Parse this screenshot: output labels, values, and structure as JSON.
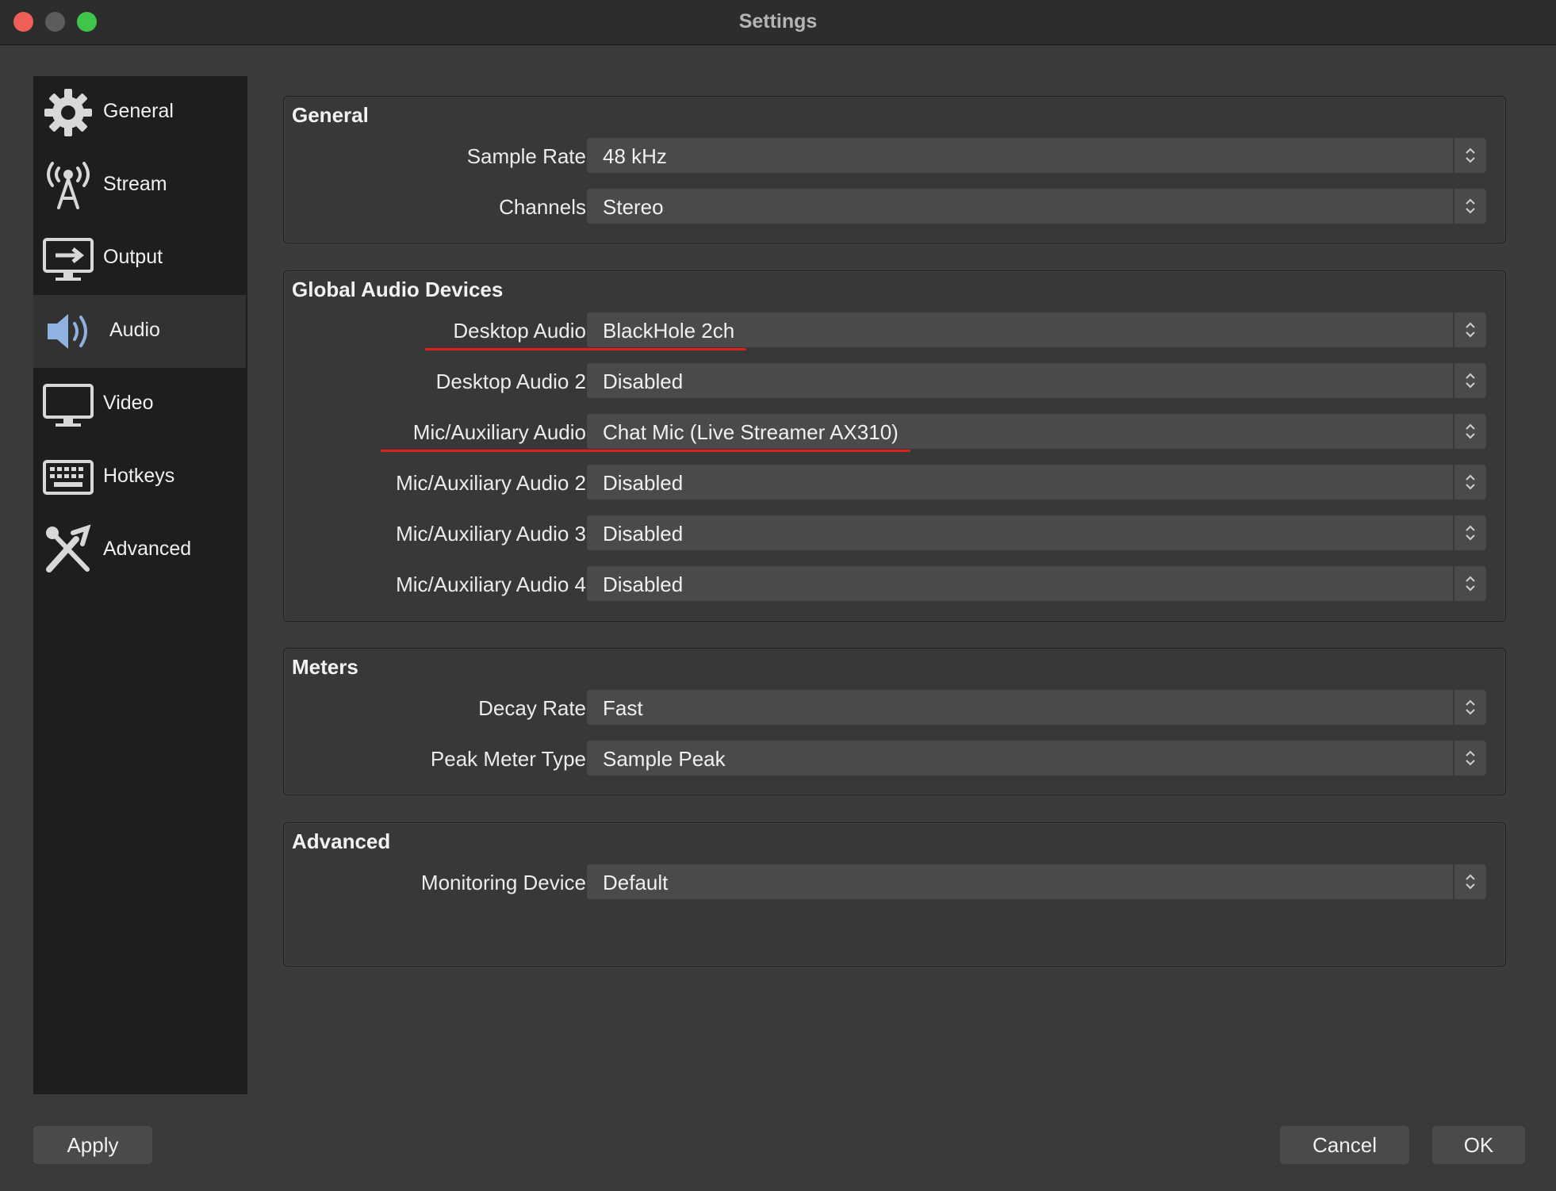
{
  "window": {
    "title": "Settings"
  },
  "sidebar": {
    "items": [
      {
        "label": "General",
        "icon": "gear-icon"
      },
      {
        "label": "Stream",
        "icon": "broadcast-tower-icon"
      },
      {
        "label": "Output",
        "icon": "monitor-output-icon"
      },
      {
        "label": "Audio",
        "icon": "speaker-icon",
        "active": true
      },
      {
        "label": "Video",
        "icon": "monitor-icon"
      },
      {
        "label": "Hotkeys",
        "icon": "keyboard-icon"
      },
      {
        "label": "Advanced",
        "icon": "tools-icon"
      }
    ]
  },
  "general": {
    "title": "General",
    "sample_rate": {
      "label": "Sample Rate",
      "value": "48 kHz"
    },
    "channels": {
      "label": "Channels",
      "value": "Stereo"
    }
  },
  "devices": {
    "title": "Global Audio Devices",
    "desktop_audio": {
      "label": "Desktop Audio",
      "value": "BlackHole 2ch"
    },
    "desktop_audio_2": {
      "label": "Desktop Audio 2",
      "value": "Disabled"
    },
    "mic_audio": {
      "label": "Mic/Auxiliary Audio",
      "value": "Chat Mic (Live Streamer AX310)"
    },
    "mic_audio_2": {
      "label": "Mic/Auxiliary Audio 2",
      "value": "Disabled"
    },
    "mic_audio_3": {
      "label": "Mic/Auxiliary Audio 3",
      "value": "Disabled"
    },
    "mic_audio_4": {
      "label": "Mic/Auxiliary Audio 4",
      "value": "Disabled"
    }
  },
  "meters": {
    "title": "Meters",
    "decay_rate": {
      "label": "Decay Rate",
      "value": "Fast"
    },
    "peak_meter_type": {
      "label": "Peak Meter Type",
      "value": "Sample Peak"
    }
  },
  "advanced": {
    "title": "Advanced",
    "monitoring_device": {
      "label": "Monitoring Device",
      "value": "Default"
    }
  },
  "buttons": {
    "apply": "Apply",
    "cancel": "Cancel",
    "ok": "OK"
  },
  "colors": {
    "annotation_underline": "#e0201b",
    "close": "#ee5f57",
    "maximize": "#3fc54a",
    "audio_icon_accent": "#8fb3e0"
  }
}
